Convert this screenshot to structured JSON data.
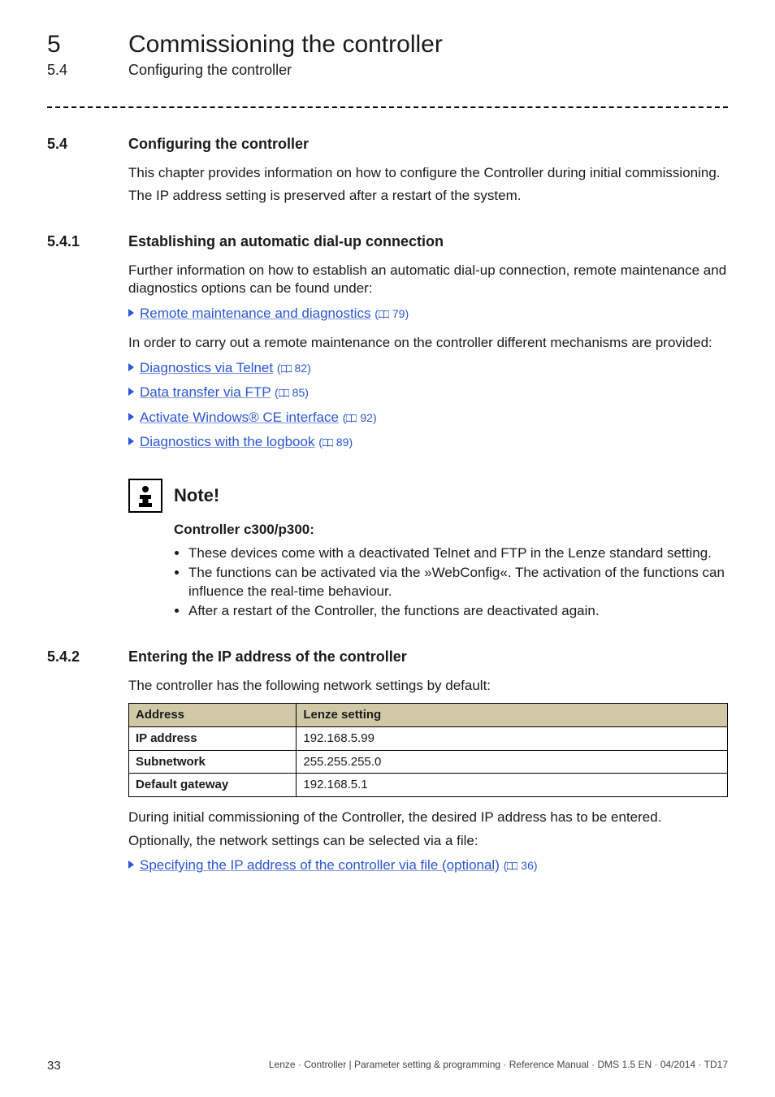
{
  "header": {
    "chapter_number": "5",
    "chapter_title": "Commissioning the controller",
    "section_number": "5.4",
    "section_title": "Configuring the controller"
  },
  "s54": {
    "num": "5.4",
    "heading": "Configuring the controller",
    "p1": "This chapter provides information on how to configure the Controller during initial commissioning.",
    "p2": "The IP address setting is preserved after a restart of the system."
  },
  "s541": {
    "num": "5.4.1",
    "heading": "Establishing an automatic dial-up connection",
    "p1": "Further information on how to establish an automatic dial-up connection, remote maintenance and diagnostics options can be found under:",
    "link_remote": {
      "label": "Remote maintenance and diagnostics",
      "page": "79"
    },
    "p2": "In order to carry out a remote maintenance on the controller different mechanisms are provided:",
    "links": [
      {
        "label": "Diagnostics via Telnet",
        "page": "82"
      },
      {
        "label": "Data transfer via FTP",
        "page": "85"
      },
      {
        "label": "Activate Windows® CE interface",
        "page": "92"
      },
      {
        "label": "Diagnostics with the logbook",
        "page": "89"
      }
    ]
  },
  "note": {
    "title": "Note!",
    "strong": "Controller c300/p300:",
    "bullets": [
      "These devices come with a deactivated Telnet and FTP in the Lenze standard setting.",
      "The functions can be activated via the »WebConfig«. The activation of the functions can influence the real-time behaviour.",
      "After a restart of the Controller, the functions are deactivated again."
    ]
  },
  "s542": {
    "num": "5.4.2",
    "heading": "Entering the IP address of the controller",
    "p1": "The controller has the following network settings by default:",
    "table": {
      "headers": [
        "Address",
        "Lenze setting"
      ],
      "rows": [
        [
          "IP address",
          "192.168.5.99"
        ],
        [
          "Subnetwork",
          "255.255.255.0"
        ],
        [
          "Default gateway",
          "192.168.5.1"
        ]
      ]
    },
    "p2": "During initial commissioning of the Controller, the desired IP address has to be entered.",
    "p3": "Optionally, the network settings can be selected via a file:",
    "link_file": {
      "label": "Specifying the IP address of the controller via file (optional)",
      "page": "36"
    }
  },
  "footer": {
    "page": "33",
    "line": "Lenze · Controller | Parameter setting & programming · Reference Manual · DMS 1.5 EN · 04/2014 · TD17"
  }
}
